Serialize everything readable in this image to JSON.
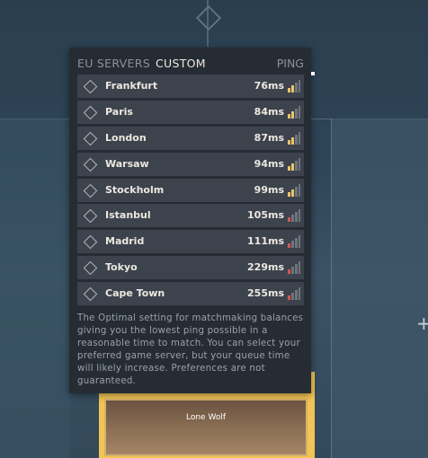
{
  "tabs": {
    "eu_servers": "EU SERVERS",
    "custom": "CUSTOM"
  },
  "ping_header": "PING",
  "servers": [
    {
      "name": "Frankfurt",
      "ping": "76ms",
      "quality": "good"
    },
    {
      "name": "Paris",
      "ping": "84ms",
      "quality": "good"
    },
    {
      "name": "London",
      "ping": "87ms",
      "quality": "good"
    },
    {
      "name": "Warsaw",
      "ping": "94ms",
      "quality": "good"
    },
    {
      "name": "Stockholm",
      "ping": "99ms",
      "quality": "good"
    },
    {
      "name": "Istanbul",
      "ping": "105ms",
      "quality": "bad"
    },
    {
      "name": "Madrid",
      "ping": "111ms",
      "quality": "bad"
    },
    {
      "name": "Tokyo",
      "ping": "229ms",
      "quality": "bad"
    },
    {
      "name": "Cape Town",
      "ping": "255ms",
      "quality": "bad"
    }
  ],
  "description": "The Optimal setting for matchmaking balances giving you the lowest ping possible in a reasonable time to match. You can select your preferred game server, but your queue time will likely increase. Preferences are not guaranteed.",
  "card_label": "Lone Wolf",
  "colors": {
    "good_signal": "#e8c46a",
    "bad_signal": "#d8544c",
    "card_border": "#f2c453"
  }
}
